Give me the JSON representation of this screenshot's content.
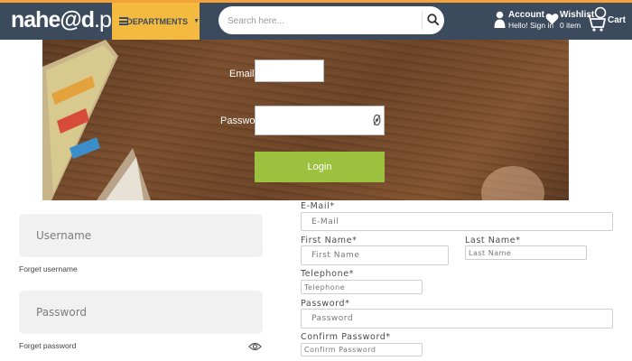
{
  "header": {
    "logo_main": "nahe@d",
    "logo_suffix": ".pk",
    "departments_label": "DEPARTMENTS",
    "search_placeholder": "Search here...",
    "account_title": "Account",
    "account_sub": "Hello! Sign in",
    "wishlist_title": "Wishlist",
    "wishlist_sub": "0 item",
    "cart_label": "Cart",
    "colors": {
      "bar": "#3b4a5c",
      "accent": "#f3ba3f",
      "top_stripe": "#f3a13a"
    }
  },
  "banner": {
    "email_label": "Email",
    "password_label": "Password",
    "login_button": "Login",
    "login_button_color": "#9cc13e"
  },
  "left_form": {
    "username_placeholder": "Username",
    "forgot_username": "Forget username",
    "password_placeholder": "Password",
    "forgot_password": "Forget password"
  },
  "right_form": {
    "email_label": "E-Mail*",
    "email_placeholder": "E-Mail",
    "first_name_label": "First Name*",
    "first_name_placeholder": "First Name",
    "last_name_label": "Last Name*",
    "last_name_placeholder": "Last Name",
    "telephone_label": "Telephone*",
    "telephone_placeholder": "Telephone",
    "password_label": "Password*",
    "password_placeholder": "Password",
    "confirm_password_label": "Confirm Password*",
    "confirm_password_placeholder": "Confirm Password"
  }
}
